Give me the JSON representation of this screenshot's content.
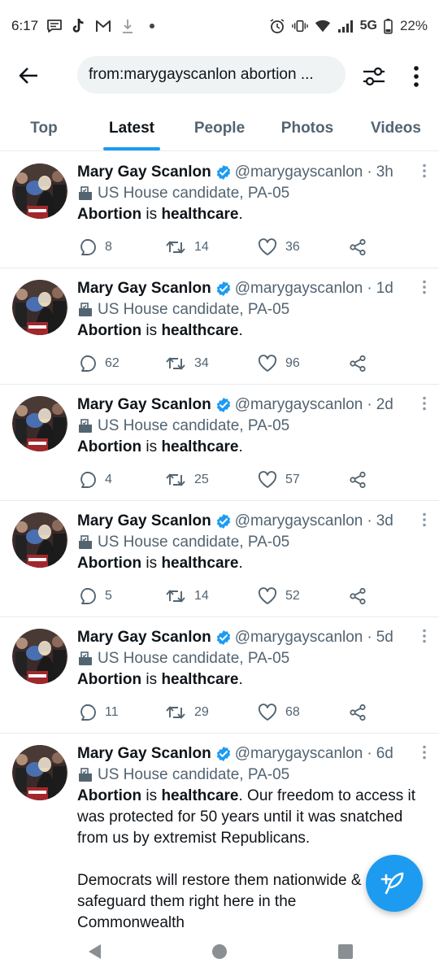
{
  "status_bar": {
    "time": "6:17",
    "network": "5G",
    "battery": "22%",
    "left_icons": [
      "message-icon",
      "tiktok-icon",
      "gmail-icon",
      "download-icon",
      "dot-icon"
    ],
    "right_icons": [
      "alarm-icon",
      "vibrate-icon",
      "wifi-icon",
      "signal-icon",
      "battery-icon"
    ]
  },
  "search": {
    "query": "from:marygayscanlon abortion ..."
  },
  "tabs": [
    {
      "label": "Top",
      "active": false
    },
    {
      "label": "Latest",
      "active": true
    },
    {
      "label": "People",
      "active": false
    },
    {
      "label": "Photos",
      "active": false
    },
    {
      "label": "Videos",
      "active": false
    }
  ],
  "tweets": [
    {
      "author": "Mary Gay Scanlon",
      "handle": "@marygayscanlon",
      "sep": "·",
      "time": "3h",
      "label": "US House candidate, PA-05",
      "text_bold1": "Abortion",
      "text_mid": " is ",
      "text_bold2": "healthcare",
      "text_end": ".",
      "replies": "8",
      "retweets": "14",
      "likes": "36"
    },
    {
      "author": "Mary Gay Scanlon",
      "handle": "@marygayscanlon",
      "sep": "·",
      "time": "1d",
      "label": "US House candidate, PA-05",
      "text_bold1": "Abortion",
      "text_mid": " is ",
      "text_bold2": "healthcare",
      "text_end": ".",
      "replies": "62",
      "retweets": "34",
      "likes": "96"
    },
    {
      "author": "Mary Gay Scanlon",
      "handle": "@marygayscanlon",
      "sep": "·",
      "time": "2d",
      "label": "US House candidate, PA-05",
      "text_bold1": "Abortion",
      "text_mid": " is ",
      "text_bold2": "healthcare",
      "text_end": ".",
      "replies": "4",
      "retweets": "25",
      "likes": "57"
    },
    {
      "author": "Mary Gay Scanlon",
      "handle": "@marygayscanlon",
      "sep": "·",
      "time": "3d",
      "label": "US House candidate, PA-05",
      "text_bold1": "Abortion",
      "text_mid": " is ",
      "text_bold2": "healthcare",
      "text_end": ".",
      "replies": "5",
      "retweets": "14",
      "likes": "52"
    },
    {
      "author": "Mary Gay Scanlon",
      "handle": "@marygayscanlon",
      "sep": "·",
      "time": "5d",
      "label": "US House candidate, PA-05",
      "text_bold1": "Abortion",
      "text_mid": " is ",
      "text_bold2": "healthcare",
      "text_end": ".",
      "replies": "11",
      "retweets": "29",
      "likes": "68"
    }
  ],
  "long_tweet": {
    "author": "Mary Gay Scanlon",
    "handle": "@marygayscanlon",
    "sep": "·",
    "time": "6d",
    "label": "US House candidate, PA-05",
    "text_bold1": "Abortion",
    "text_mid": " is ",
    "text_bold2": "healthcare",
    "text_rest": ". Our freedom to access it was protected for 50 years until it was snatched from us by extremist Republicans.",
    "para2": "Democrats will restore them nationwide & safeguard them right here in the Commonwealth"
  },
  "colors": {
    "accent": "#1d9bf0",
    "text": "#0f1419",
    "secondary": "#536471",
    "divider": "#e6ecf0",
    "search_bg": "#eff3f4"
  },
  "icons": {
    "back": "arrow-left-icon",
    "filter": "sliders-icon",
    "more": "vertical-dots-icon",
    "reply": "speech-bubble-icon",
    "retweet": "retweet-icon",
    "like": "heart-icon",
    "share": "share-icon",
    "verified": "verified-badge-icon",
    "label": "ballot-box-icon",
    "compose": "feather-plus-icon"
  }
}
